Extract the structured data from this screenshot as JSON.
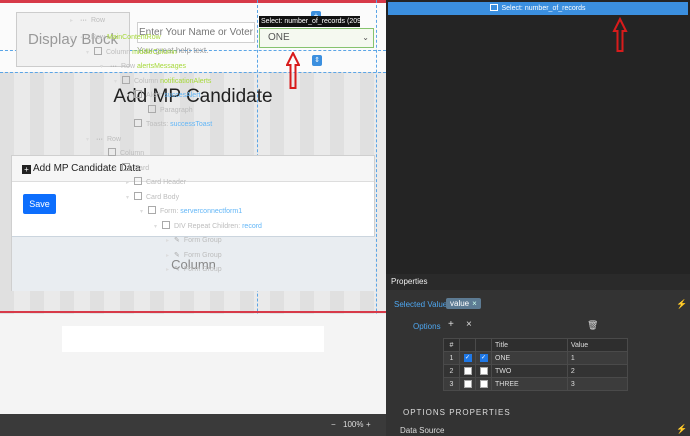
{
  "canvas": {
    "display_block": "Display Block",
    "name_input_placeholder": "Enter Your Name or Voter",
    "help_text": "Your great help text.",
    "select_tooltip": "Select: number_of_records (209",
    "select_value": "ONE",
    "page_title": "Add MP Candidate",
    "card_header": "Add MP Candidate Data",
    "save_label": "Save",
    "column_label": "Column",
    "zoom_minus": "−",
    "zoom_value": "100%",
    "zoom_plus": "+"
  },
  "tree": {
    "header": "Select: number_of_records",
    "rows": [
      {
        "type": "Row",
        "name": ""
      },
      {
        "type": "Row",
        "name": "MainContentRow"
      },
      {
        "type": "Column",
        "name": "middleColumn"
      },
      {
        "type": "Row",
        "name": "alertsMessages"
      },
      {
        "type": "Column",
        "name": "notificationAlerts"
      },
      {
        "type": "Alert:",
        "name": "succesAlert"
      },
      {
        "type": "Paragraph",
        "name": ""
      },
      {
        "type": "Toasts:",
        "name": "successToast"
      },
      {
        "type": "Row",
        "name": ""
      },
      {
        "type": "Column",
        "name": ""
      },
      {
        "type": "Card",
        "name": ""
      },
      {
        "type": "Card Header",
        "name": ""
      },
      {
        "type": "Card Body",
        "name": ""
      },
      {
        "type": "Form:",
        "name": "serverconnectform1"
      },
      {
        "type": "DIV Repeat Children:",
        "name": "record"
      },
      {
        "type": "Form Group",
        "name": ""
      },
      {
        "type": "Form Group",
        "name": ""
      },
      {
        "type": "Form Group",
        "name": ""
      }
    ]
  },
  "properties": {
    "title": "Properties",
    "selected_value_label": "Selected Value",
    "selected_value_tag": "value",
    "tag_remove": "×",
    "options_label": "Options",
    "add": "+",
    "remove": "×",
    "options_columns": [
      "#",
      "",
      "",
      "Title",
      "Value"
    ],
    "options_rows": [
      {
        "num": "1",
        "checked1": true,
        "checked2": true,
        "title": "ONE",
        "value": "1"
      },
      {
        "num": "2",
        "checked1": false,
        "checked2": false,
        "title": "TWO",
        "value": "2"
      },
      {
        "num": "3",
        "checked1": false,
        "checked2": false,
        "title": "THREE",
        "value": "3"
      }
    ],
    "options_properties_title": "OPTIONS PROPERTIES",
    "data_source_label": "Data Source"
  },
  "colors": {
    "accent": "#3b8fdf",
    "brand_red": "#d73a49",
    "arrow": "#d81b1b",
    "link": "#4ea6ef",
    "name_green": "#a6d83a"
  }
}
